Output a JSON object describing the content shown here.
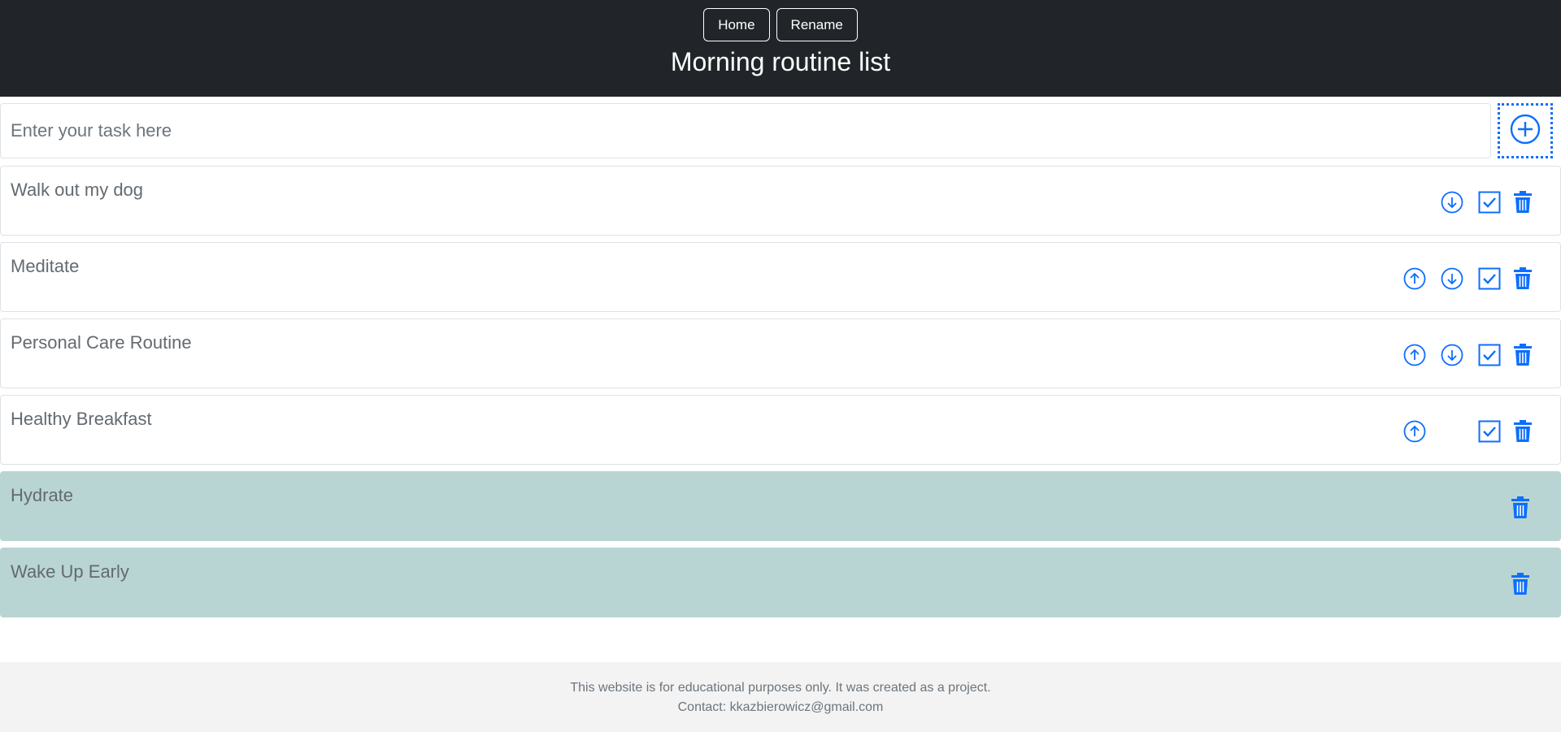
{
  "nav": {
    "home_label": "Home",
    "rename_label": "Rename"
  },
  "page": {
    "title": "Morning routine list"
  },
  "add_task": {
    "placeholder": "Enter your task here",
    "value": ""
  },
  "tasks": [
    {
      "label": "Walk out my dog",
      "completed": false,
      "actions": [
        "move-down",
        "complete",
        "delete"
      ]
    },
    {
      "label": "Meditate",
      "completed": false,
      "actions": [
        "move-up",
        "move-down",
        "complete",
        "delete"
      ]
    },
    {
      "label": "Personal Care Routine",
      "completed": false,
      "actions": [
        "move-up",
        "move-down",
        "complete",
        "delete"
      ]
    },
    {
      "label": "Healthy Breakfast",
      "completed": false,
      "actions": [
        "move-up",
        "complete",
        "delete"
      ]
    },
    {
      "label": "Hydrate",
      "completed": true,
      "actions": [
        "delete"
      ]
    },
    {
      "label": "Wake Up Early",
      "completed": true,
      "actions": [
        "delete"
      ]
    }
  ],
  "footer": {
    "line1": "This website is for educational purposes only. It was created as a project.",
    "line2": "Contact: kkazbierowicz@gmail.com"
  },
  "colors": {
    "header_bg": "#212529",
    "accent": "#0d6efd",
    "completed_bg": "#b9d5d3",
    "footer_bg": "#f3f3f3"
  }
}
